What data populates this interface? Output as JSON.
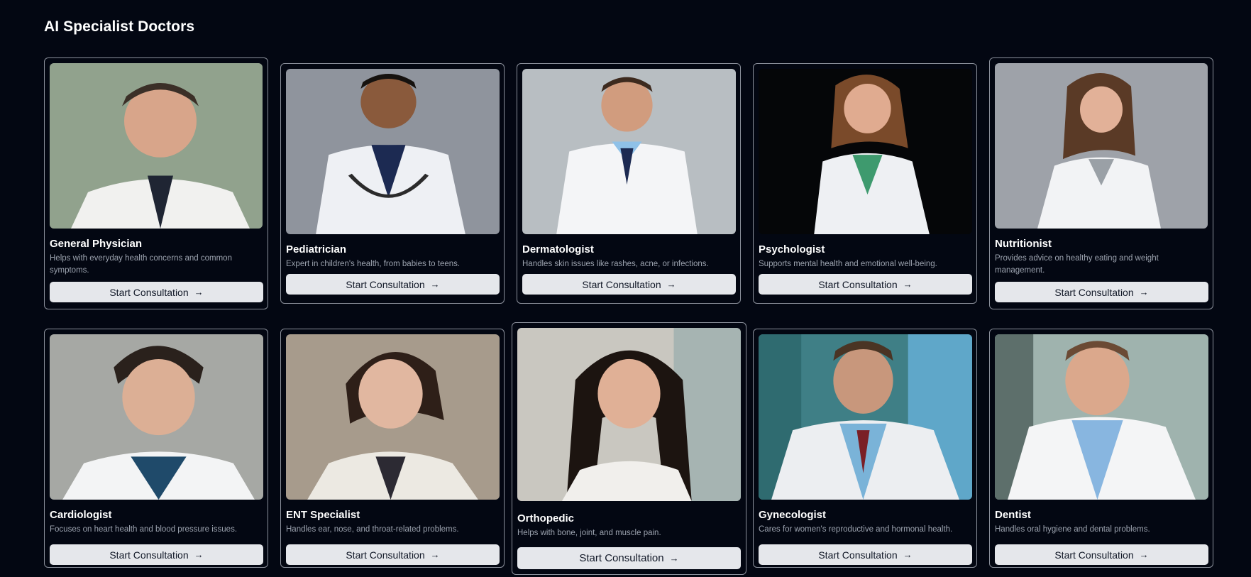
{
  "page": {
    "title": "AI Specialist Doctors"
  },
  "doctors": [
    {
      "name": "General Physician",
      "description": "Helps with everyday health concerns and common symptoms.",
      "button_label": "Start Consultation",
      "photo": "doctor-photo-general-physician"
    },
    {
      "name": "Pediatrician",
      "description": "Expert in children's health, from babies to teens.",
      "button_label": "Start Consultation",
      "photo": "doctor-photo-pediatrician"
    },
    {
      "name": "Dermatologist",
      "description": "Handles skin issues like rashes, acne, or infections.",
      "button_label": "Start Consultation",
      "photo": "doctor-photo-dermatologist"
    },
    {
      "name": "Psychologist",
      "description": "Supports mental health and emotional well-being.",
      "button_label": "Start Consultation",
      "photo": "doctor-photo-psychologist"
    },
    {
      "name": "Nutritionist",
      "description": "Provides advice on healthy eating and weight management.",
      "button_label": "Start Consultation",
      "photo": "doctor-photo-nutritionist"
    },
    {
      "name": "Cardiologist",
      "description": "Focuses on heart health and blood pressure issues.",
      "button_label": "Start Consultation",
      "photo": "doctor-photo-cardiologist"
    },
    {
      "name": "ENT Specialist",
      "description": "Handles ear, nose, and throat-related problems.",
      "button_label": "Start Consultation",
      "photo": "doctor-photo-ent-specialist"
    },
    {
      "name": "Orthopedic",
      "description": "Helps with bone, joint, and muscle pain.",
      "button_label": "Start Consultation",
      "photo": "doctor-photo-orthopedic"
    },
    {
      "name": "Gynecologist",
      "description": "Cares for women's reproductive and hormonal health.",
      "button_label": "Start Consultation",
      "photo": "doctor-photo-gynecologist"
    },
    {
      "name": "Dentist",
      "description": "Handles oral hygiene and dental problems.",
      "button_label": "Start Consultation",
      "photo": "doctor-photo-dentist"
    }
  ],
  "icons": {
    "button_icon": "arrow-right-icon"
  },
  "colors": {
    "background": "#030712",
    "card_border": "#8b909b",
    "button_bg": "#e5e7eb",
    "button_text": "#111827",
    "description_text": "#9ca3af"
  }
}
